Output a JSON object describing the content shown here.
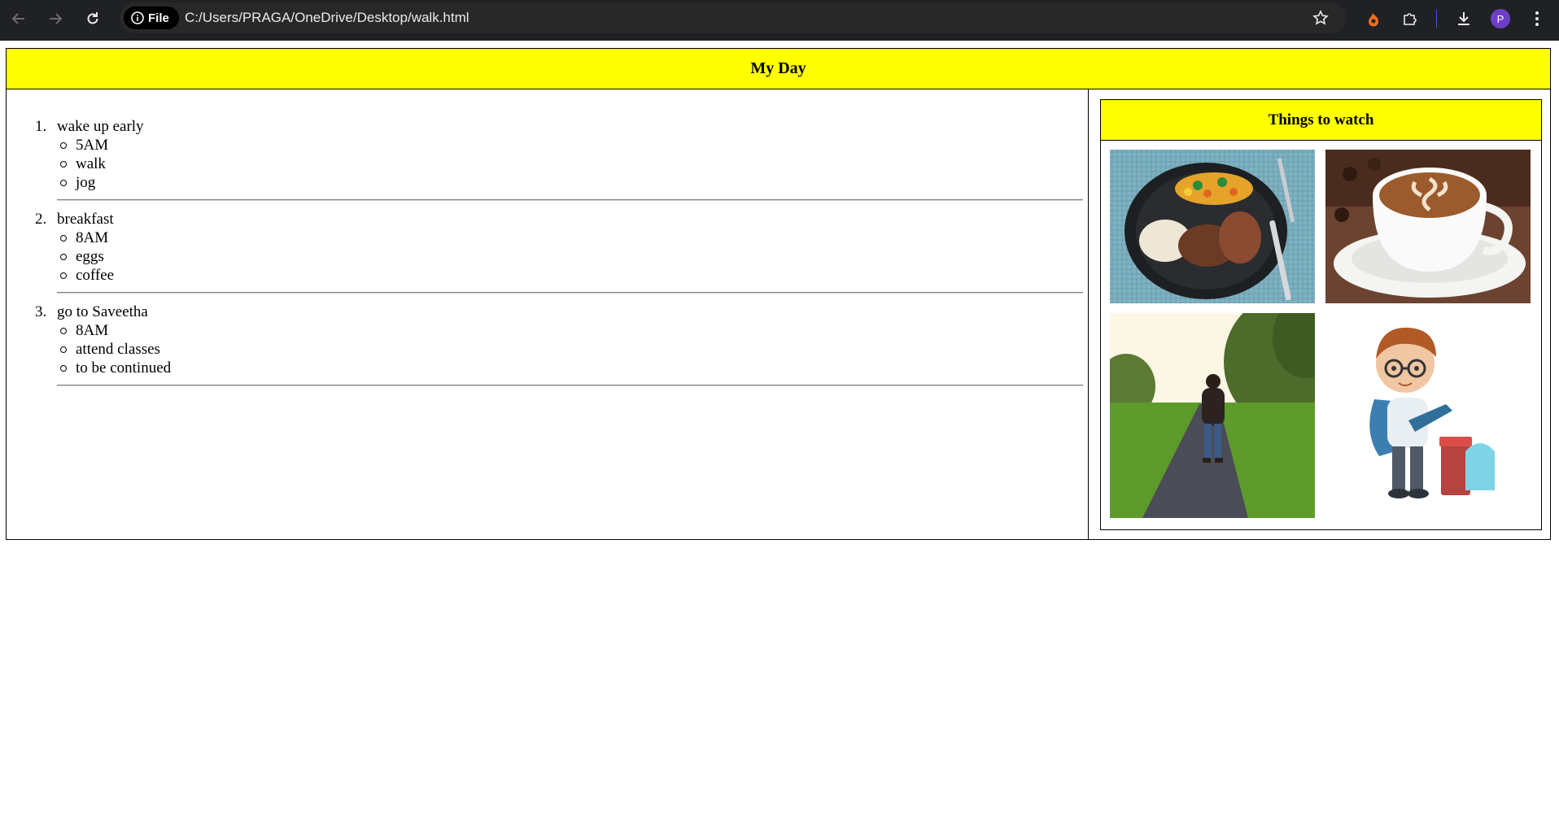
{
  "browser": {
    "chip_label": "File",
    "url": "C:/Users/PRAGA/OneDrive/Desktop/walk.html",
    "avatar_letter": "P"
  },
  "page": {
    "title": "My Day",
    "list": [
      {
        "number": "1.",
        "label": "wake up early",
        "subitems": [
          "5AM",
          "walk",
          "jog"
        ]
      },
      {
        "number": "2.",
        "label": "breakfast",
        "subitems": [
          "8AM",
          "eggs",
          "coffee"
        ]
      },
      {
        "number": "3.",
        "label": "go to Saveetha",
        "subitems": [
          "8AM",
          "attend classes",
          "to be continued"
        ]
      }
    ],
    "side_panel": {
      "title": "Things to watch",
      "images": [
        "food-plate-image",
        "coffee-cup-image",
        "walking-path-image",
        "boy-reading-image"
      ]
    }
  },
  "colors": {
    "header_bg": "#ffff00",
    "chrome_bg": "#202124"
  }
}
